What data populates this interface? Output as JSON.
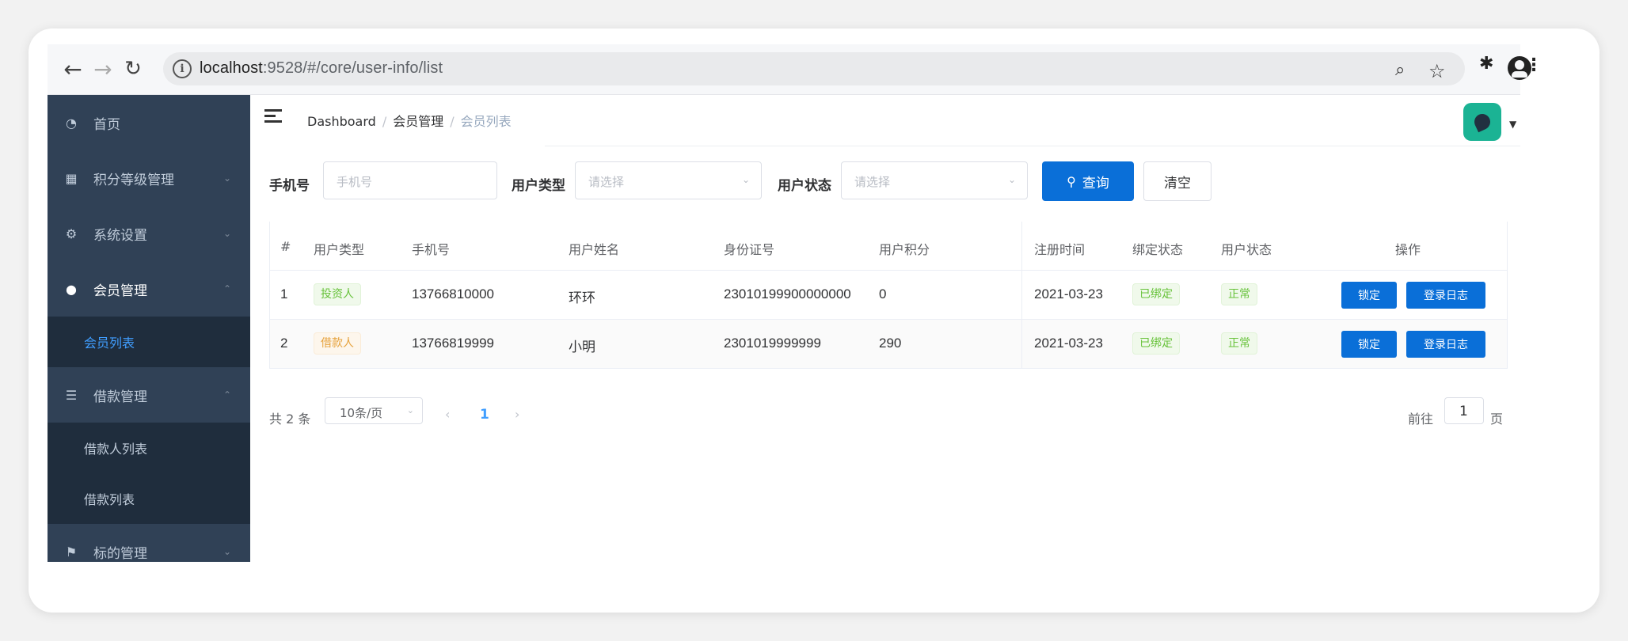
{
  "browser": {
    "url_host": "localhost",
    "url_rest": ":9528/#/core/user-info/list"
  },
  "sidebar": {
    "items": [
      {
        "label": "首页",
        "icon": "dashboard-icon"
      },
      {
        "label": "积分等级管理",
        "icon": "chart-icon"
      },
      {
        "label": "系统设置",
        "icon": "gear-icon"
      },
      {
        "label": "会员管理",
        "icon": "user-icon"
      },
      {
        "label": "借款管理",
        "icon": "list-icon"
      },
      {
        "label": "标的管理",
        "icon": "flag-icon"
      }
    ],
    "member_sub": [
      "会员列表"
    ],
    "loan_sub": [
      "借款人列表",
      "借款列表"
    ]
  },
  "breadcrumb": [
    "Dashboard",
    "会员管理",
    "会员列表"
  ],
  "search": {
    "phone_label": "手机号",
    "phone_placeholder": "手机号",
    "user_type_label": "用户类型",
    "user_type_placeholder": "请选择",
    "user_status_label": "用户状态",
    "user_status_placeholder": "请选择",
    "query_label": "查询",
    "clear_label": "清空"
  },
  "table": {
    "headers": [
      "#",
      "用户类型",
      "手机号",
      "用户姓名",
      "身份证号",
      "用户积分",
      "注册时间",
      "绑定状态",
      "用户状态",
      "操作"
    ],
    "rows": [
      {
        "index": "1",
        "user_type": "投资人",
        "phone": "13766810000",
        "name": "环环",
        "id_no": "23010199900000000",
        "points": "0",
        "reg_date": "2021-03-23",
        "bind_status": "已绑定",
        "status": "正常",
        "lock": "锁定",
        "log": "登录日志"
      },
      {
        "index": "2",
        "user_type": "借款人",
        "phone": "13766819999",
        "name": "小明",
        "id_no": "2301019999999",
        "points": "290",
        "reg_date": "2021-03-23",
        "bind_status": "已绑定",
        "status": "正常",
        "lock": "锁定",
        "log": "登录日志"
      }
    ]
  },
  "pagination": {
    "total": "共 2 条",
    "page_size": "10条/页",
    "current_page": "1",
    "goto_prefix": "前往",
    "goto_value": "1",
    "goto_suffix": "页"
  },
  "colors": {
    "sidebar_bg": "#304156",
    "primary": "#0a6fd8",
    "active_link": "#409eff"
  }
}
